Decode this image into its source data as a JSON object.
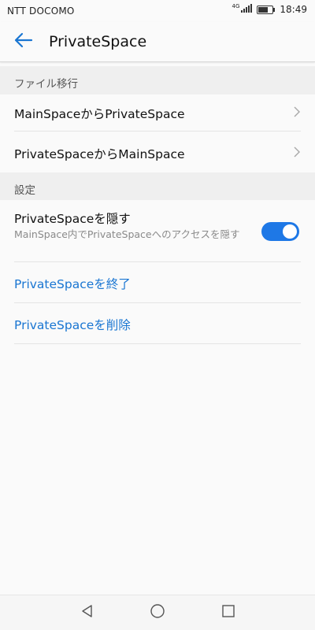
{
  "status_bar": {
    "carrier": "NTT DOCOMO",
    "network": "4G",
    "time": "18:49"
  },
  "app_bar": {
    "title": "PrivateSpace",
    "back_icon": "arrow-left-icon"
  },
  "sections": {
    "file_transfer": {
      "header": "ファイル移行",
      "items": [
        {
          "label": "MainSpaceからPrivateSpace"
        },
        {
          "label": "PrivateSpaceからMainSpace"
        }
      ]
    },
    "settings": {
      "header": "設定",
      "hide": {
        "label": "PrivateSpaceを隠す",
        "description": "MainSpace内でPrivateSpaceへのアクセスを隠す",
        "enabled": true
      },
      "exit_label": "PrivateSpaceを終了",
      "delete_label": "PrivateSpaceを削除"
    }
  },
  "colors": {
    "accent": "#1a76d2",
    "toggle_on": "#1e78e6"
  },
  "nav_bar": {
    "icons": [
      "back-triangle-icon",
      "home-circle-icon",
      "recents-square-icon"
    ]
  }
}
